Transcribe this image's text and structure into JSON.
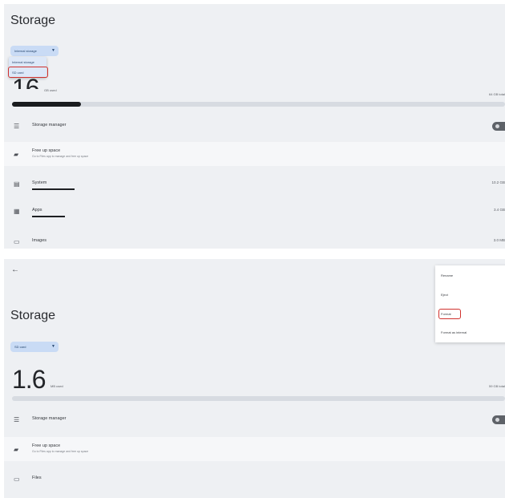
{
  "screen1": {
    "title": "Storage",
    "chip_label": "Internal storage",
    "dropdown_options": [
      "Internal storage",
      "SD card"
    ],
    "big_number": "16",
    "used_label": "GB used",
    "total_label": "64 GB total",
    "storage_fraction": 0.14,
    "rows": [
      {
        "icon": "storage-manager-icon",
        "label": "Storage manager"
      },
      {
        "icon": "cleanup-icon",
        "label": "Free up space",
        "sub": "Go to Files app to manage and free up space"
      },
      {
        "icon": "system-icon",
        "label": "System",
        "value": "10.2 GB",
        "fraction": 0.09
      },
      {
        "icon": "apps-icon",
        "label": "Apps",
        "value": "3.4 GB",
        "fraction": 0.07
      },
      {
        "icon": "images-icon",
        "label": "Images",
        "value": "3.0 MB"
      }
    ]
  },
  "screen2": {
    "title": "Storage",
    "chip_label": "SD card",
    "big_number": "1.6",
    "used_label": "MB used",
    "total_label": "59 GB total",
    "menu_items": [
      "Rename",
      "Eject",
      "Format",
      "Format as internal"
    ],
    "rows": [
      {
        "icon": "storage-manager-icon",
        "label": "Storage manager"
      },
      {
        "icon": "cleanup-icon",
        "label": "Free up space",
        "sub": "Go to Files app to manage and free up space"
      },
      {
        "icon": "folder-icon",
        "label": "Files"
      }
    ]
  },
  "colors": {
    "background": "#eef0f3",
    "chip": "#c9dbf5",
    "highlight_box": "#d0312d",
    "bar_fill": "#1a1c1f"
  }
}
